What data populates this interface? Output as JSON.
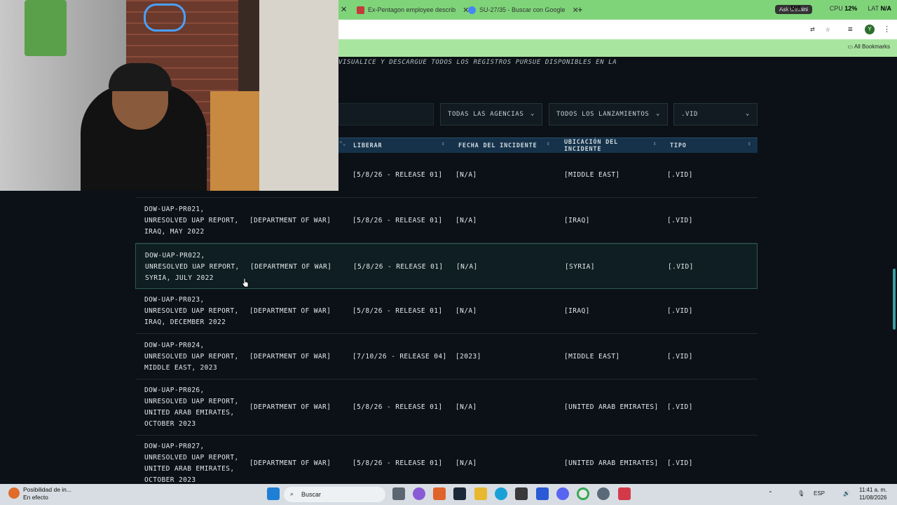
{
  "browser": {
    "tabs": [
      {
        "title": "Ex-Pentagon employee describ"
      },
      {
        "title": "SU-27/35 - Buscar con Google"
      }
    ],
    "stats": {
      "fps_label": "FPS",
      "fps_value": "N/A",
      "cpu_label": "CPU",
      "cpu_value": "12%",
      "lat_label": "LAT",
      "lat_value": "N/A"
    },
    "gemini_label": "Ask Gemini",
    "profile_initial": "Y",
    "bookmarks_label": "All Bookmarks"
  },
  "page": {
    "subtitle": "VISUALICE Y DESCARGUE TODOS LOS REGISTROS PURSUE DISPONIBLES EN LA",
    "filters": {
      "agency": "TODAS LAS AGENCIAS",
      "release": "TODOS LOS LANZAMIENTOS",
      "type": ".VID"
    },
    "columns": [
      "LIBERAR",
      "FECHA DEL INCIDENTE",
      "UBICACIÓN DEL INCIDENTE",
      "TIPO"
    ],
    "rows": [
      {
        "title": "",
        "agency": "",
        "release": "[5/8/26 - RELEASE 01]",
        "date": "[N/A]",
        "location": "[MIDDLE EAST]",
        "type": "[.VID]"
      },
      {
        "title": "DOW-UAP-PR021,\nUNRESOLVED UAP REPORT,\nIRAQ, MAY 2022",
        "agency": "[DEPARTMENT OF WAR]",
        "release": "[5/8/26 - RELEASE 01]",
        "date": "[N/A]",
        "location": "[IRAQ]",
        "type": "[.VID]"
      },
      {
        "title": "DOW-UAP-PR022,\nUNRESOLVED UAP REPORT,\nSYRIA, JULY 2022",
        "agency": "[DEPARTMENT OF WAR]",
        "release": "[5/8/26 - RELEASE 01]",
        "date": "[N/A]",
        "location": "[SYRIA]",
        "type": "[.VID]"
      },
      {
        "title": "DOW-UAP-PR023,\nUNRESOLVED UAP REPORT,\nIRAQ, DECEMBER 2022",
        "agency": "[DEPARTMENT OF WAR]",
        "release": "[5/8/26 - RELEASE 01]",
        "date": "[N/A]",
        "location": "[IRAQ]",
        "type": "[.VID]"
      },
      {
        "title": "DOW-UAP-PR024,\nUNRESOLVED UAP REPORT,\nMIDDLE EAST, 2023",
        "agency": "[DEPARTMENT OF WAR]",
        "release": "[7/10/26 - RELEASE 04]",
        "date": "[2023]",
        "location": "[MIDDLE EAST]",
        "type": "[.VID]"
      },
      {
        "title": "DOW-UAP-PR026,\nUNRESOLVED UAP REPORT,\nUNITED ARAB EMIRATES,\nOCTOBER 2023",
        "agency": "[DEPARTMENT OF WAR]",
        "release": "[5/8/26 - RELEASE 01]",
        "date": "[N/A]",
        "location": "[UNITED ARAB EMIRATES]",
        "type": "[.VID]"
      },
      {
        "title": "DOW-UAP-PR027,\nUNRESOLVED UAP REPORT,\nUNITED ARAB EMIRATES,\nOCTOBER 2023",
        "agency": "[DEPARTMENT OF WAR]",
        "release": "[5/8/26 - RELEASE 01]",
        "date": "[N/A]",
        "location": "[UNITED ARAB EMIRATES]",
        "type": "[.VID]"
      }
    ]
  },
  "taskbar": {
    "weather_title": "Posibilidad de in...",
    "weather_sub": "En efecto",
    "search_label": "Buscar",
    "lang": "ESP",
    "time": "11:41 a. m.",
    "date": "11/08/2026"
  },
  "colors": {
    "accent": "#15324a",
    "highlight_border": "#2a5a56",
    "chrome_green": "#a8e6a0"
  }
}
